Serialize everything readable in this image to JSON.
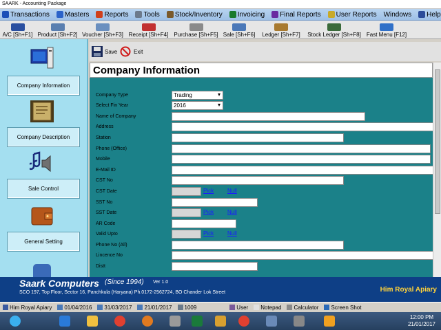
{
  "window": {
    "title": "SAARK - Accounting Package"
  },
  "menu": [
    {
      "label": "Transactions",
      "color": "#1a4fb8"
    },
    {
      "label": "Masters",
      "color": "#2b63c9"
    },
    {
      "label": "Reports",
      "color": "#d0401c"
    },
    {
      "label": "Tools",
      "color": "#6c7a8c"
    },
    {
      "label": "Stock/Inventory",
      "color": "#7a5a2b"
    },
    {
      "label": "Invoicing",
      "color": "#1a7b2c"
    },
    {
      "label": "Final Reports",
      "color": "#6a2ca0"
    },
    {
      "label": "User Reports",
      "color": "#c8aa2a"
    },
    {
      "label": "Windows",
      "color": ""
    },
    {
      "label": "Help",
      "color": "#2b4c9a"
    }
  ],
  "toolbar": [
    {
      "label": "A/C [Sh+F1]",
      "icon": "account-icon",
      "color": "#2a4fa0"
    },
    {
      "label": "Product [Sh+F2]",
      "icon": "product-icon",
      "color": "#5a7fb0"
    },
    {
      "label": "Voucher [Sh+F3]",
      "icon": "voucher-icon",
      "color": "#6a8fbf"
    },
    {
      "label": "Receipt [Sh+F4]",
      "icon": "receipt-icon",
      "color": "#c23030"
    },
    {
      "label": "Purchase [Sh+F5]",
      "icon": "purchase-icon",
      "color": "#8a8a8a"
    },
    {
      "label": "Sale [Sh+F6]",
      "icon": "sale-icon",
      "color": "#4a78b8"
    },
    {
      "label": "Ledger [Sh+F7]",
      "icon": "ledger-icon",
      "color": "#a87a30"
    },
    {
      "label": "Stock Ledger [Sh+F8]",
      "icon": "stock-ledger-icon",
      "color": "#3a6a3a"
    },
    {
      "label": "Fast Menu [F12]",
      "icon": "fast-menu-icon",
      "color": "#3070c8"
    }
  ],
  "left_panel": [
    {
      "label": "Company Information",
      "icon": "monitor-icon"
    },
    {
      "label": "Company Description",
      "icon": "scroll-icon"
    },
    {
      "label": "Sale Control",
      "icon": "speaker-icon"
    },
    {
      "label": "General Setting",
      "icon": "wallet-icon"
    }
  ],
  "form_toolbar": {
    "save": "Save",
    "exit": "Exit"
  },
  "form": {
    "title": "Company Information",
    "fields": [
      {
        "label": "Company Type",
        "kind": "select",
        "value": "Trading"
      },
      {
        "label": "Select Fin Year",
        "kind": "select",
        "value": "2016"
      },
      {
        "label": "Name of Company",
        "kind": "text",
        "value": ""
      },
      {
        "label": "Address",
        "kind": "text",
        "value": ""
      },
      {
        "label": "Station",
        "kind": "text",
        "value": ""
      },
      {
        "label": "Phone (Office)",
        "kind": "text",
        "value": ""
      },
      {
        "label": "Mobile",
        "kind": "text",
        "value": ""
      },
      {
        "label": "E-Mail ID",
        "kind": "text",
        "value": ""
      },
      {
        "label": "CST No",
        "kind": "text",
        "value": ""
      },
      {
        "label": "CST Date",
        "kind": "date",
        "value": "",
        "pick": "Pick",
        "null": "Null"
      },
      {
        "label": "SST No",
        "kind": "text",
        "value": ""
      },
      {
        "label": "SST Date",
        "kind": "date",
        "value": "",
        "pick": "Pick",
        "null": "Null"
      },
      {
        "label": "AR Code",
        "kind": "text",
        "value": ""
      },
      {
        "label": "Valid Upto",
        "kind": "date",
        "value": "",
        "pick": "Pick",
        "null": "Null"
      },
      {
        "label": "Phone No (All)",
        "kind": "text",
        "value": ""
      },
      {
        "label": "Lincence No",
        "kind": "text",
        "value": ""
      },
      {
        "label": "Distt",
        "kind": "text",
        "value": ""
      }
    ]
  },
  "footer": {
    "company": "Saark Computers",
    "since": "(Since 1994)",
    "version": "Ver 1.0",
    "address": "SCO 197, Top Floor, Sector 16, Panchkula (Haryana) Ph.0172-2562724,  BO Chander Lok Street",
    "right_name": "Him Royal Apiary"
  },
  "status_bar": [
    {
      "text": "Him Royal Apiary",
      "icon": "computer-icon"
    },
    {
      "text": "01/04/2016",
      "icon": "calendar-icon"
    },
    {
      "text": "31/03/2017",
      "icon": "calendar-icon"
    },
    {
      "text": "21/01/2017",
      "icon": "calendar-icon"
    },
    {
      "text": "1009",
      "icon": "server-icon"
    },
    {
      "text": "User",
      "icon": "user-icon"
    },
    {
      "text": "Notepad",
      "icon": "notepad-icon"
    },
    {
      "text": "Calculator",
      "icon": "calculator-icon"
    },
    {
      "text": "Screen Shot",
      "icon": "camera-icon"
    }
  ],
  "taskbar": {
    "time": "12:00 PM",
    "date": "21/01/2017",
    "apps": [
      "start-icon",
      "ie-icon",
      "explorer-icon",
      "chrome-icon",
      "firefox-icon",
      "app-icon",
      "excel-icon",
      "folder-icon",
      "chrome-icon",
      "paint-icon",
      "settings-icon",
      "media-icon"
    ]
  }
}
